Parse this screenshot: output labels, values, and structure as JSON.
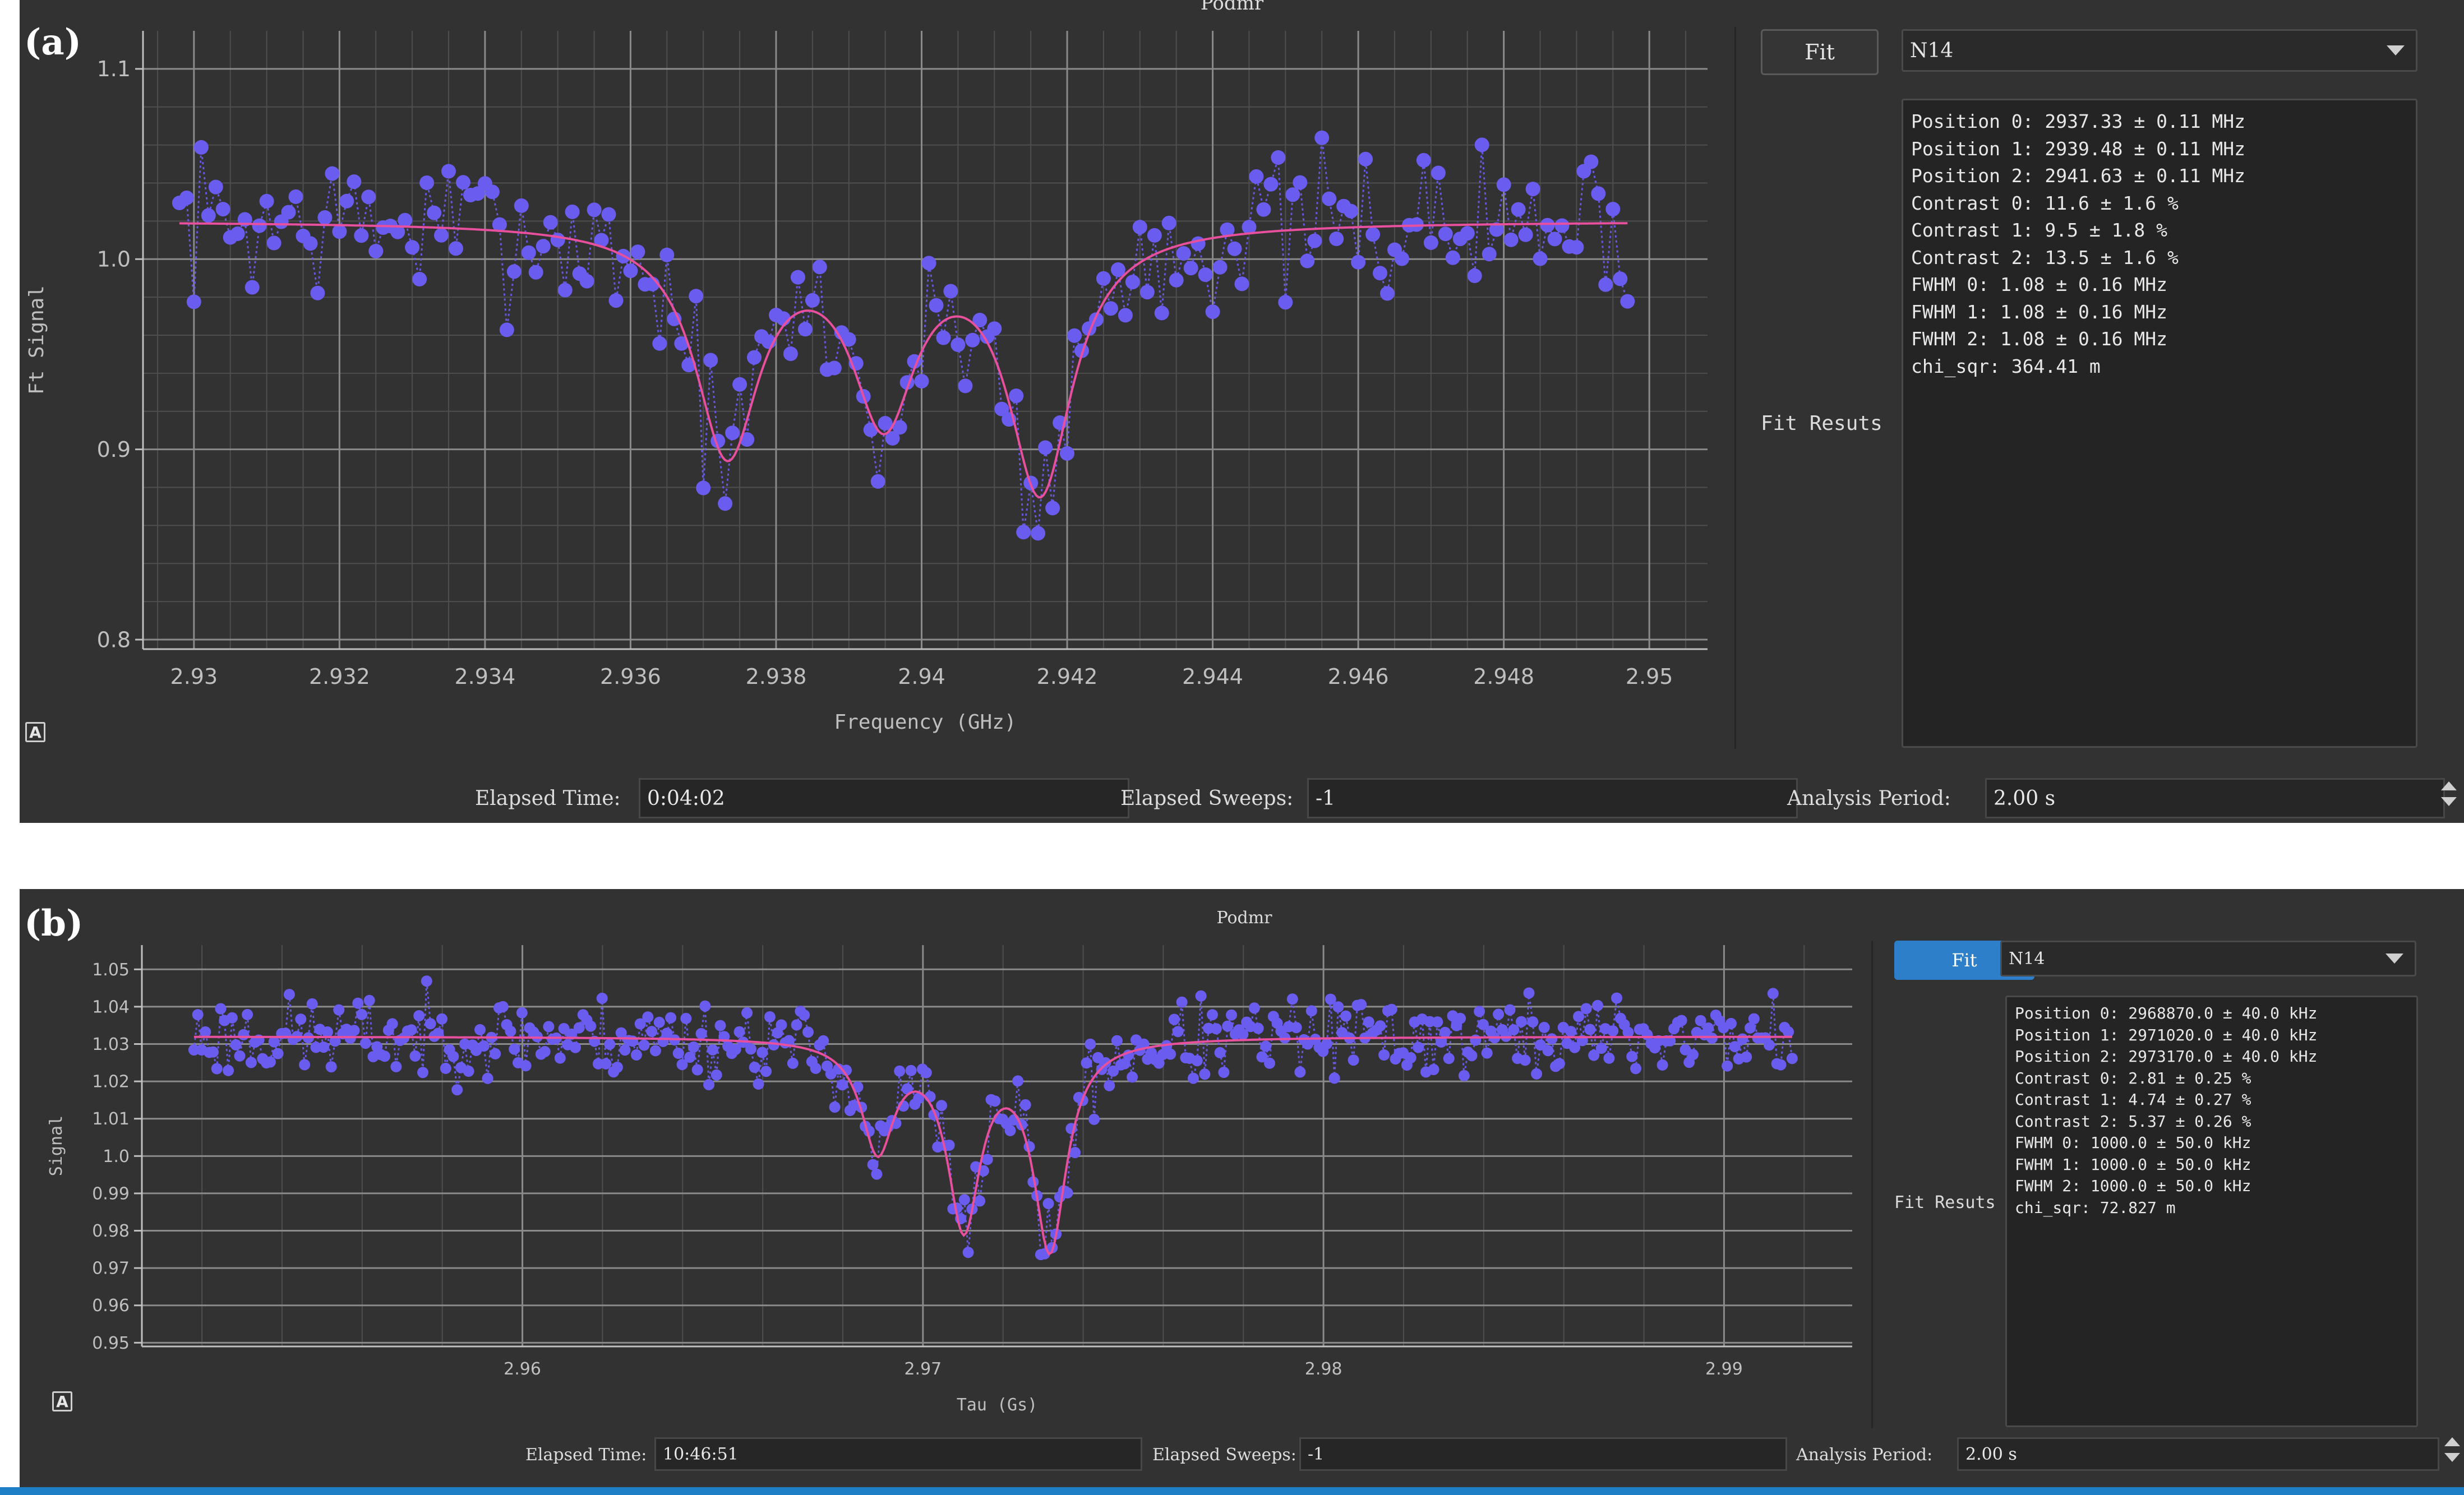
{
  "panels": {
    "a": {
      "panel_label": "(a)",
      "window_title": "Podmr",
      "fit_button": "Fit",
      "fit_model": "N14",
      "fit_results_label": "Fit Resuts",
      "fit_results": [
        "Position 0: 2937.33 ± 0.11 MHz",
        "Position 1: 2939.48 ± 0.11 MHz",
        "Position 2: 2941.63 ± 0.11 MHz",
        "Contrast 0: 11.6 ± 1.6 %",
        "Contrast 1: 9.5 ± 1.8 %",
        "Contrast 2: 13.5 ± 1.6 %",
        "FWHM 0: 1.08 ± 0.16 MHz",
        "FWHM 1: 1.08 ± 0.16 MHz",
        "FWHM 2: 1.08 ± 0.16 MHz",
        "chi_sqr: 364.41 m"
      ],
      "status": {
        "elapsed_time_label": "Elapsed Time:",
        "elapsed_time": "0:04:02",
        "elapsed_sweeps_label": "Elapsed Sweeps:",
        "elapsed_sweeps": "-1",
        "analysis_period_label": "Analysis Period:",
        "analysis_period": "2.00 s"
      },
      "auto_range_label": "A",
      "colors": {
        "points": "#6b5cf0",
        "fit": "#e8509e",
        "grid": "#4e4e4e",
        "axis": "#bfbfbf"
      }
    },
    "b": {
      "panel_label": "(b)",
      "window_title": "Podmr",
      "fit_button": "Fit",
      "fit_model": "N14",
      "fit_results_label": "Fit Resuts",
      "fit_results": [
        "Position 0: 2968870.0 ± 40.0 kHz",
        "Position 1: 2971020.0 ± 40.0 kHz",
        "Position 2: 2973170.0 ± 40.0 kHz",
        "Contrast 0: 2.81 ± 0.25 %",
        "Contrast 1: 4.74 ± 0.27 %",
        "Contrast 2: 5.37 ± 0.26 %",
        "FWHM 0: 1000.0 ± 50.0 kHz",
        "FWHM 1: 1000.0 ± 50.0 kHz",
        "FWHM 2: 1000.0 ± 50.0 kHz",
        "chi_sqr: 72.827 m"
      ],
      "status": {
        "elapsed_time_label": "Elapsed Time:",
        "elapsed_time": "10:46:51",
        "elapsed_sweeps_label": "Elapsed Sweeps:",
        "elapsed_sweeps": "-1",
        "analysis_period_label": "Analysis Period:",
        "analysis_period": "2.00 s"
      },
      "auto_range_label": "A",
      "colors": {
        "points": "#6b5cf0",
        "fit": "#e8509e",
        "grid": "#4e4e4e",
        "axis": "#bfbfbf"
      }
    }
  },
  "chart_data": [
    {
      "type": "scatter",
      "title": "",
      "xlabel": "Frequency (GHz)",
      "ylabel": "Ft Signal",
      "xlim": [
        2.9293,
        2.9508
      ],
      "ylim": [
        0.795,
        1.12
      ],
      "x_ticks": [
        "2.93",
        "2.932",
        "2.934",
        "2.936",
        "2.938",
        "2.94",
        "2.942",
        "2.944",
        "2.946",
        "2.948",
        "2.95"
      ],
      "x_tick_values": [
        2.93,
        2.932,
        2.934,
        2.936,
        2.938,
        2.94,
        2.942,
        2.944,
        2.946,
        2.948,
        2.95
      ],
      "y_ticks": [
        "0.8",
        "0.9",
        "1.0",
        "1.1"
      ],
      "y_tick_values": [
        0.8,
        0.9,
        1.0,
        1.1
      ],
      "grid": true,
      "x_range": [
        2.9298,
        2.9497
      ],
      "n_points": 200,
      "baseline": 1.02,
      "fit": {
        "model": "3 Lorentzian dips",
        "centers": [
          2.93733,
          2.93948,
          2.94163
        ],
        "contrasts": [
          0.116,
          0.095,
          0.135
        ],
        "fwhm": [
          0.00108,
          0.00108,
          0.00108
        ]
      },
      "noise_amplitude": 0.045,
      "noise_seed": 7
    },
    {
      "type": "scatter",
      "title": "",
      "xlabel": "Tau (Gs)",
      "ylabel": "Signal",
      "xlim": [
        2.9505,
        2.9932
      ],
      "ylim": [
        0.949,
        1.0565
      ],
      "x_ticks": [
        "2.96",
        "2.97",
        "2.98",
        "2.99"
      ],
      "x_tick_values": [
        2.96,
        2.97,
        2.98,
        2.99
      ],
      "y_ticks": [
        "0.95",
        "0.96",
        "0.97",
        "0.98",
        "0.99",
        "1.0",
        "1.01",
        "1.02",
        "1.03",
        "1.04",
        "1.05"
      ],
      "y_tick_values": [
        0.95,
        0.96,
        0.97,
        0.98,
        0.99,
        1.0,
        1.01,
        1.02,
        1.03,
        1.04,
        1.05
      ],
      "grid": true,
      "x_range": [
        2.9518,
        2.9917
      ],
      "n_points": 420,
      "baseline": 1.032,
      "fit": {
        "model": "3 Lorentzian dips",
        "centers": [
          2.96887,
          2.97102,
          2.97317
        ],
        "contrasts": [
          0.0281,
          0.0474,
          0.0537
        ],
        "fwhm": [
          0.001,
          0.001,
          0.001
        ]
      },
      "noise_amplitude": 0.012,
      "noise_seed": 23
    }
  ]
}
